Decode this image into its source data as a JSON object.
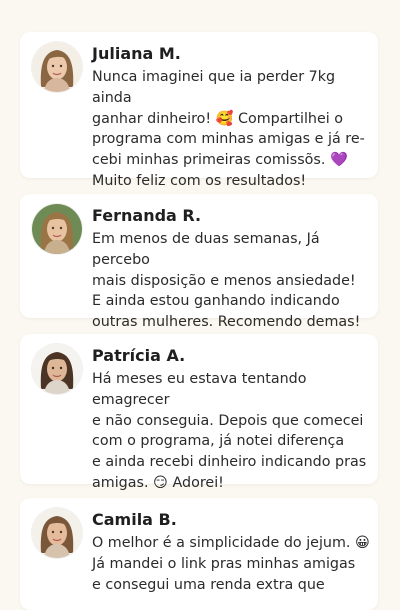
{
  "testimonials": [
    {
      "name": "Juliana M.",
      "text": "Nunca imaginei que ia perder 7kg ainda\nganhar dinheiro! 🥰 Compartilhei o\nprograma com minhas amigas e já re-\ncebi minhas primeiras comissõs. 💜\nMuito feliz com os resultados!",
      "background": "#f3efe6"
    },
    {
      "name": "Fernanda R.",
      "text": "Em menos de duas semanas, Já percebo\nmais disposição e menos ansiedade!\nE ainda estou ganhando indicando\noutras mulheres. Recomendo demas!",
      "background": "#6f8b55"
    },
    {
      "name": "Patrícia A.",
      "text": "Há meses eu estava tentando emagrecer\ne não conseguia. Depois que comecei\ncom o programa, já notei diferença\ne ainda recebi dinheiro indicando pras\namigas. 😏 Adorei!",
      "background": "#f5f3ef"
    },
    {
      "name": "Camila B.",
      "text": "O melhor é a simplicidade do jejum. 😀\nJá mandei o link pras minhas amigas\ne consegui uma renda extra que",
      "background": "#f4f0ea"
    }
  ],
  "colors": {
    "page_background": "#fbf8f1",
    "card_background": "#ffffff",
    "name_color": "#1f1f1f",
    "text_color": "#2b2b2b"
  }
}
